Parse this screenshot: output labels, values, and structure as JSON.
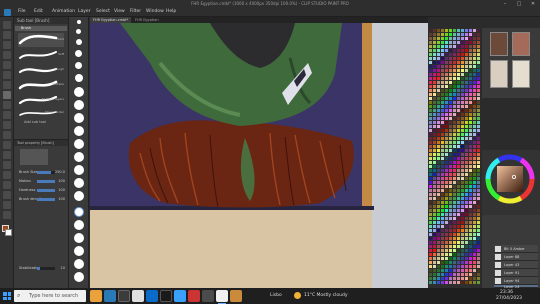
{
  "window": {
    "title": "FHR Egyptian.cmbl* (3000 x 4000px 350dpi 100.0%)  - CLIP STUDIO PAINT PRO"
  },
  "menu": [
    "File",
    "Edit",
    "Animation",
    "Layer",
    "Select",
    "View",
    "Filter",
    "Window",
    "Help"
  ],
  "tabs": [
    "FHR Egyptian.cmbl*",
    "FHR Egyptian"
  ],
  "subtool": {
    "header": "Sub tool [Brush]",
    "group": "Brush",
    "items": [
      {
        "label": "Hard",
        "selected": true
      },
      {
        "label": "Soft",
        "selected": false
      },
      {
        "label": "Rough",
        "selected": false
      },
      {
        "label": "Multiple",
        "selected": false
      },
      {
        "label": "Multiple layers",
        "selected": false
      },
      {
        "label": "Show render",
        "selected": false
      }
    ],
    "add": "Add sub tool"
  },
  "toolprop": {
    "header": "Tool property [Brush]",
    "rows": [
      {
        "label": "Brush Size",
        "value": "250.0",
        "pct": 0.8
      },
      {
        "label": "Motion",
        "value": "100",
        "pct": 1.0
      },
      {
        "label": "Hardness",
        "value": "100",
        "pct": 1.0
      },
      {
        "label": "Brush density",
        "value": "100",
        "pct": 1.0
      },
      {
        "label": "Stabilization",
        "value": "10",
        "pct": 0.15
      }
    ]
  },
  "layers": [
    {
      "label": "Bit 5 Amber",
      "selected": false
    },
    {
      "label": "Layer 88",
      "selected": false
    },
    {
      "label": "Layer 43",
      "selected": false
    },
    {
      "label": "Layer 91",
      "selected": false
    },
    {
      "label": "Layer 94",
      "selected": false
    },
    {
      "label": "Layer 24",
      "selected": true
    }
  ],
  "taskbar": {
    "search_placeholder": "Type here to search",
    "weather_label": "Lisbo",
    "weather": "11°C  Mostly cloudy",
    "time": "23:36",
    "date": "27/04/2023"
  },
  "colors": {
    "accent": "#3aa0ff",
    "selection": "#5a6f8a",
    "main_color": "#a04a1a"
  },
  "icons": {
    "search": "search-icon",
    "start": "windows-icon",
    "minimize": "minimize-icon",
    "maximize": "maximize-icon",
    "close": "close-icon"
  },
  "winctl": {
    "minimize": "–",
    "maximize": "□",
    "close": "✕"
  },
  "search_glyph": "⌕"
}
